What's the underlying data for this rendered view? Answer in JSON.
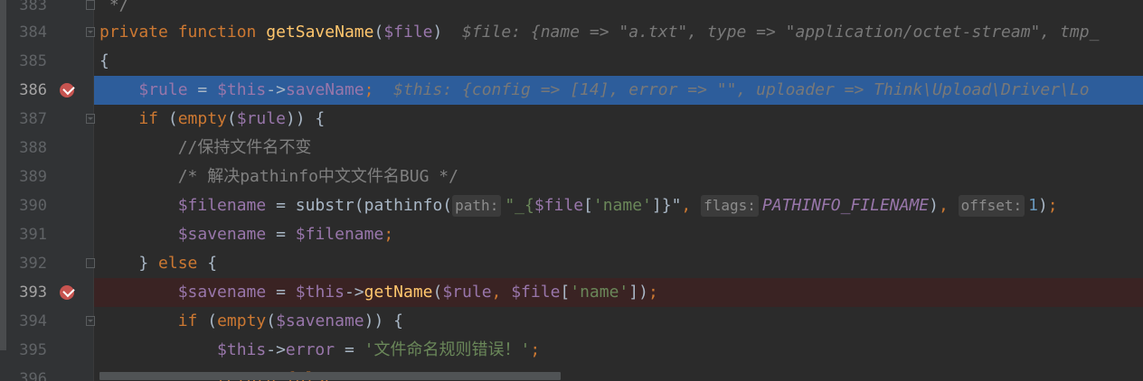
{
  "editor": {
    "lines": [
      {
        "n": "383",
        "tokens": [
          [
            "com",
            " */"
          ]
        ]
      },
      {
        "n": "384",
        "tokens": [
          [
            "kw",
            "private "
          ],
          [
            "kw",
            "function "
          ],
          [
            "fn",
            "getSaveName"
          ],
          [
            "plain",
            "("
          ],
          [
            "var",
            "$file"
          ],
          [
            "plain",
            ")  "
          ],
          [
            "inlay",
            "$file: {name => \"a.txt\", type => \"application/octet-stream\", tmp_"
          ]
        ]
      },
      {
        "n": "385",
        "tokens": [
          [
            "plain",
            "{"
          ]
        ]
      },
      {
        "n": "386",
        "tokens": [
          [
            "var",
            "    $rule "
          ],
          [
            "plain",
            "= "
          ],
          [
            "var",
            "$this"
          ],
          [
            "plain",
            "->"
          ],
          [
            "var",
            "saveName"
          ],
          [
            "punc",
            ";  "
          ],
          [
            "inlay",
            "$this: {config => [14], error => \"\", uploader => Think\\Upload\\Driver\\Lo"
          ]
        ]
      },
      {
        "n": "387",
        "tokens": [
          [
            "kw",
            "    if "
          ],
          [
            "plain",
            "("
          ],
          [
            "kw",
            "empty"
          ],
          [
            "plain",
            "("
          ],
          [
            "var",
            "$rule"
          ],
          [
            "plain",
            ")) {"
          ]
        ]
      },
      {
        "n": "388",
        "tokens": [
          [
            "com",
            "        //保持文件名不变"
          ]
        ]
      },
      {
        "n": "389",
        "tokens": [
          [
            "com",
            "        /* 解决pathinfo中文文件名BUG */"
          ]
        ]
      },
      {
        "n": "390",
        "tokens": [
          [
            "var",
            "        $filename "
          ],
          [
            "plain",
            "= substr(pathinfo("
          ],
          [
            "hint",
            "path:"
          ],
          [
            "str",
            "\"_{"
          ],
          [
            "var",
            "$file"
          ],
          [
            "plain",
            "["
          ],
          [
            "str",
            "'name'"
          ],
          [
            "plain",
            "]}\""
          ],
          [
            "punc",
            ", "
          ],
          [
            "hint",
            "flags:"
          ],
          [
            "const",
            "PATHINFO_FILENAME"
          ],
          [
            "plain",
            ")"
          ],
          [
            "punc",
            ", "
          ],
          [
            "hint",
            "offset:"
          ],
          [
            "num-lit",
            "1"
          ],
          [
            "plain",
            ")"
          ],
          [
            "punc",
            ";"
          ]
        ]
      },
      {
        "n": "391",
        "tokens": [
          [
            "var",
            "        $savename "
          ],
          [
            "plain",
            "= "
          ],
          [
            "var",
            "$filename"
          ],
          [
            "punc",
            ";"
          ]
        ]
      },
      {
        "n": "392",
        "tokens": [
          [
            "plain",
            "    } "
          ],
          [
            "kw",
            "else "
          ],
          [
            "plain",
            "{"
          ]
        ]
      },
      {
        "n": "393",
        "tokens": [
          [
            "var",
            "        $savename "
          ],
          [
            "plain",
            "= "
          ],
          [
            "var",
            "$this"
          ],
          [
            "plain",
            "->"
          ],
          [
            "fn",
            "getName"
          ],
          [
            "plain",
            "("
          ],
          [
            "var",
            "$rule"
          ],
          [
            "punc",
            ", "
          ],
          [
            "var",
            "$file"
          ],
          [
            "plain",
            "["
          ],
          [
            "str",
            "'name'"
          ],
          [
            "plain",
            "])"
          ],
          [
            "punc",
            ";"
          ]
        ]
      },
      {
        "n": "394",
        "tokens": [
          [
            "kw",
            "        if "
          ],
          [
            "plain",
            "("
          ],
          [
            "kw",
            "empty"
          ],
          [
            "plain",
            "("
          ],
          [
            "var",
            "$savename"
          ],
          [
            "plain",
            ")) {"
          ]
        ]
      },
      {
        "n": "395",
        "tokens": [
          [
            "var",
            "            $this"
          ],
          [
            "plain",
            "->"
          ],
          [
            "var",
            "error "
          ],
          [
            "plain",
            "= "
          ],
          [
            "str",
            "'文件命名规则错误！'"
          ],
          [
            "punc",
            ";"
          ]
        ]
      },
      {
        "n": "396",
        "tokens": [
          [
            "kw",
            "            return false"
          ],
          [
            "punc",
            ";"
          ]
        ]
      }
    ]
  }
}
